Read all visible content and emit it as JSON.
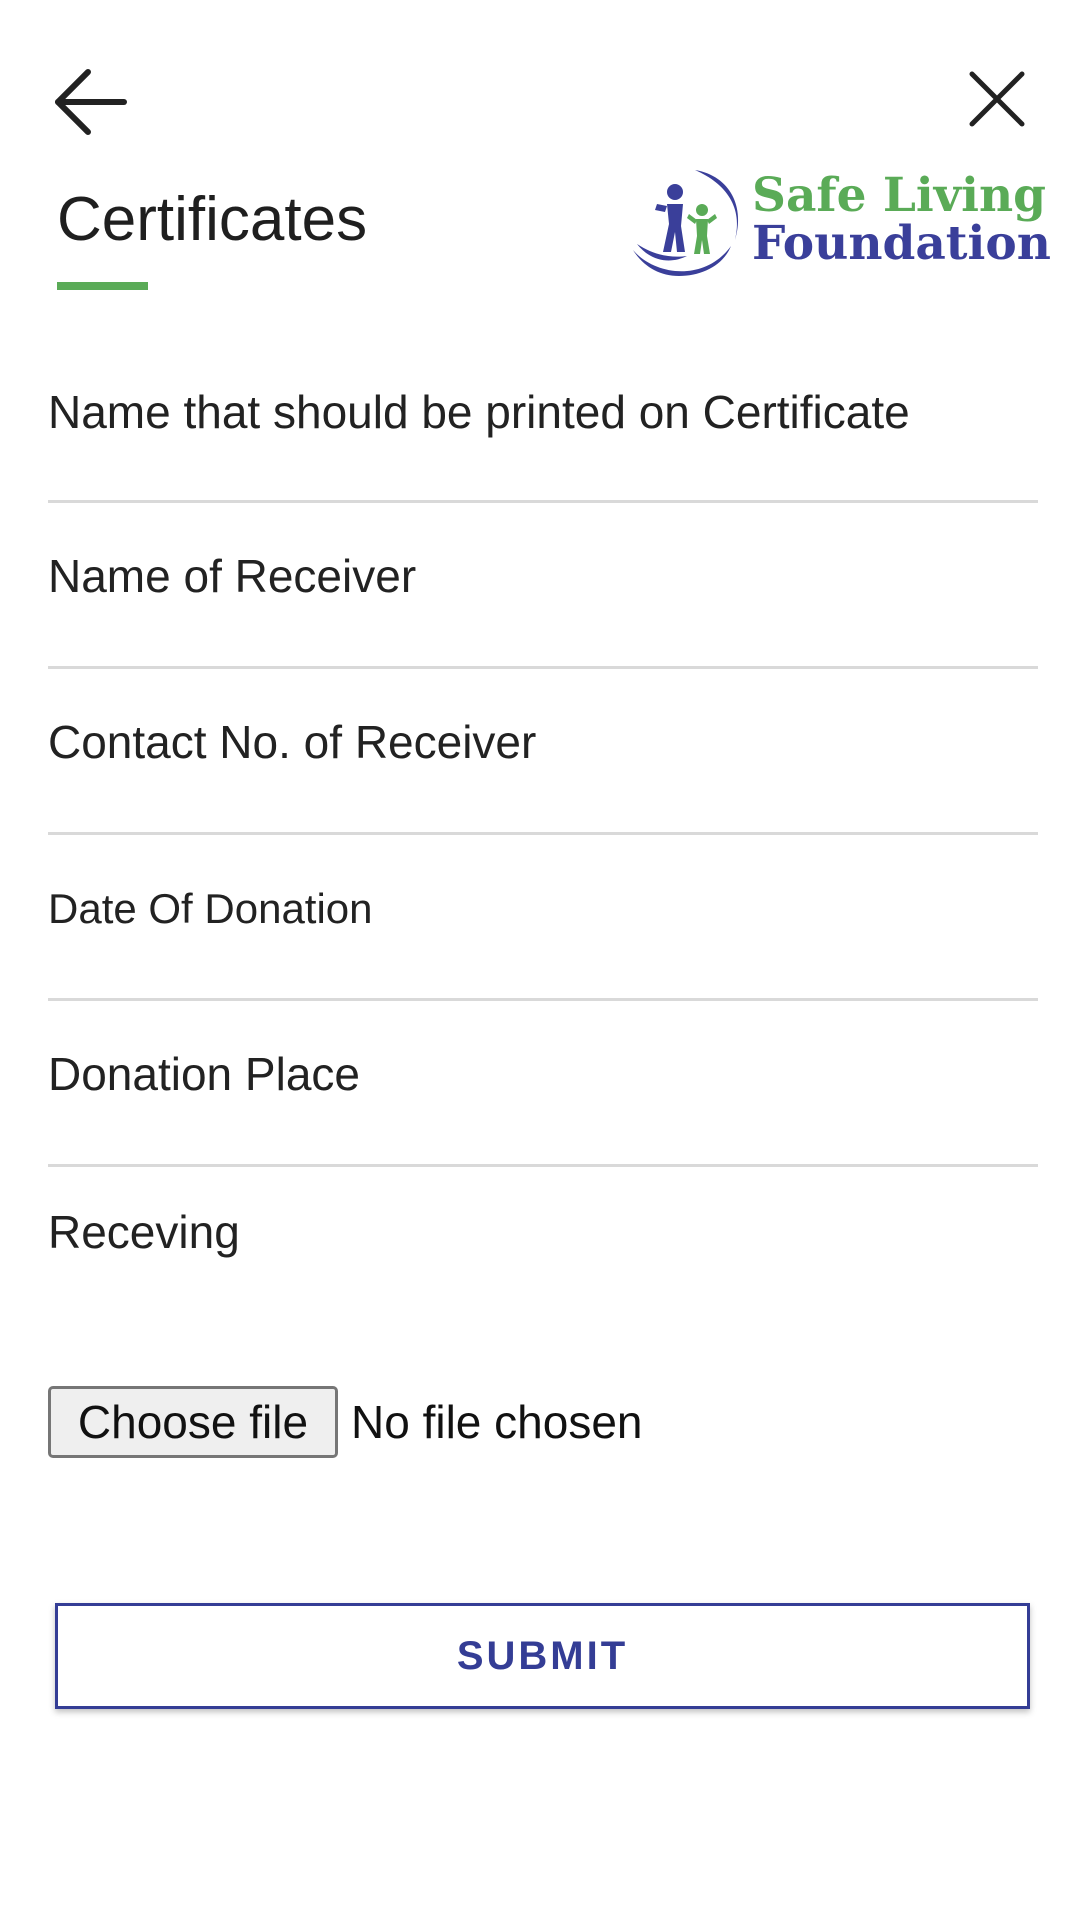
{
  "header": {
    "title": "Certificates",
    "back_icon": "arrow-left-icon",
    "close_icon": "close-icon",
    "accent_color": "#5aab57"
  },
  "logo": {
    "line1": "Safe Living",
    "line2": "Foundation",
    "green": "#5aab57",
    "blue": "#3a3f9a"
  },
  "form": {
    "fields": [
      {
        "label": "Name that should be printed on Certificate"
      },
      {
        "label": "Name of Receiver"
      },
      {
        "label": "Contact No. of Receiver"
      },
      {
        "label": "Date Of Donation"
      },
      {
        "label": "Donation Place"
      }
    ],
    "receiving_label": "Receving",
    "file_button_label": "Choose file",
    "file_status": "No file chosen",
    "submit_label": "SUBMIT",
    "submit_color": "#343d95"
  }
}
